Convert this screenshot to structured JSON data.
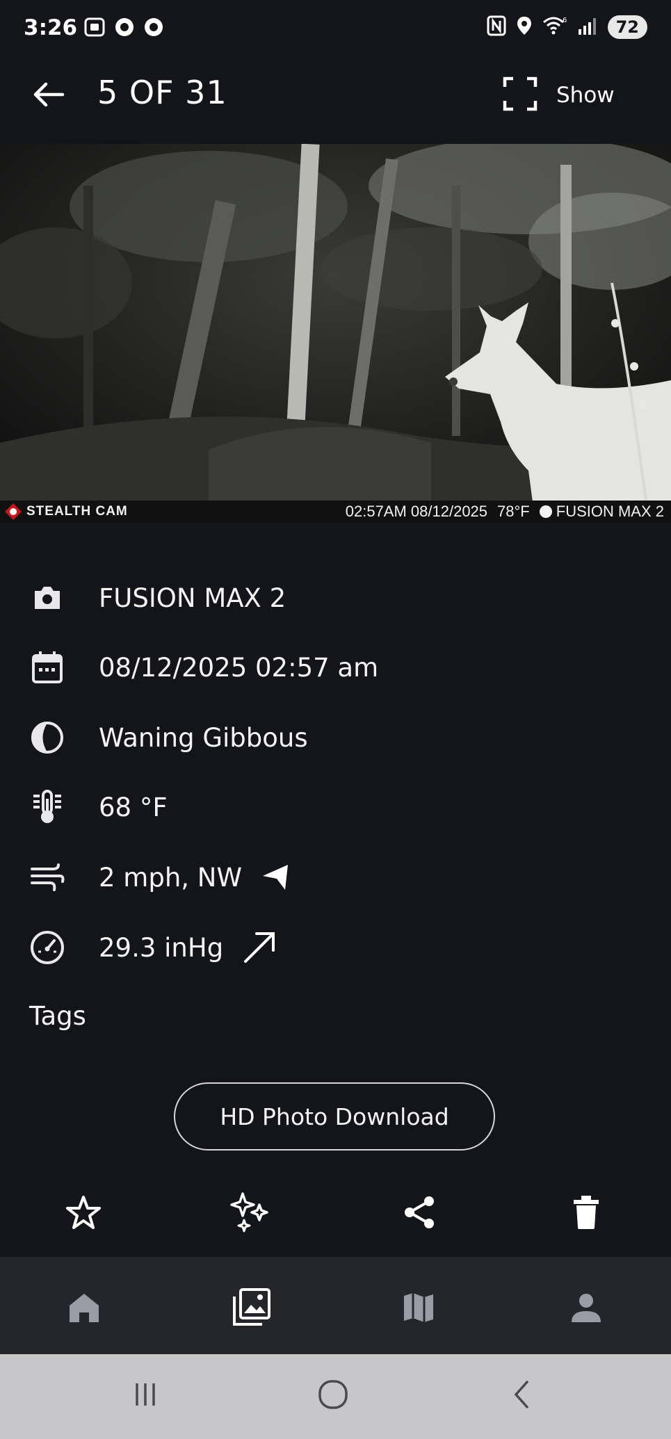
{
  "status_bar": {
    "time": "3:26",
    "battery": "72",
    "left_icons": [
      "screenshot-icon",
      "circle-app-icon",
      "circle-app-icon"
    ],
    "right_icons": [
      "nfc-icon",
      "location-icon",
      "wifi-icon",
      "signal-icon"
    ]
  },
  "header": {
    "counter": "5 OF 31",
    "show_label": "Show",
    "back_icon": "arrow-left-icon",
    "fullscreen_icon": "fullscreen-icon"
  },
  "photo": {
    "brand": "STEALTH CAM",
    "stamp_time_date": "02:57AM 08/12/2025",
    "stamp_temp": "78°F",
    "stamp_camera": "FUSION MAX 2"
  },
  "details": {
    "camera": "FUSION MAX 2",
    "datetime": "08/12/2025 02:57 am",
    "moon_phase": "Waning Gibbous",
    "temperature": "68 °F",
    "wind": "2 mph, NW",
    "pressure": "29.3 inHg"
  },
  "tags_label": "Tags",
  "hd_button": "HD Photo Download",
  "actions": [
    "star-icon",
    "sparkles-icon",
    "share-icon",
    "trash-icon"
  ],
  "bottom_nav": [
    "home-icon",
    "gallery-icon",
    "map-icon",
    "profile-icon"
  ],
  "system_nav": [
    "recents-icon",
    "home-circle-icon",
    "back-chevron-icon"
  ],
  "colors": {
    "background": "#14151a",
    "bottom_nav": "#25262c",
    "system_nav": "#c7c7c9",
    "text": "#ffffff"
  }
}
